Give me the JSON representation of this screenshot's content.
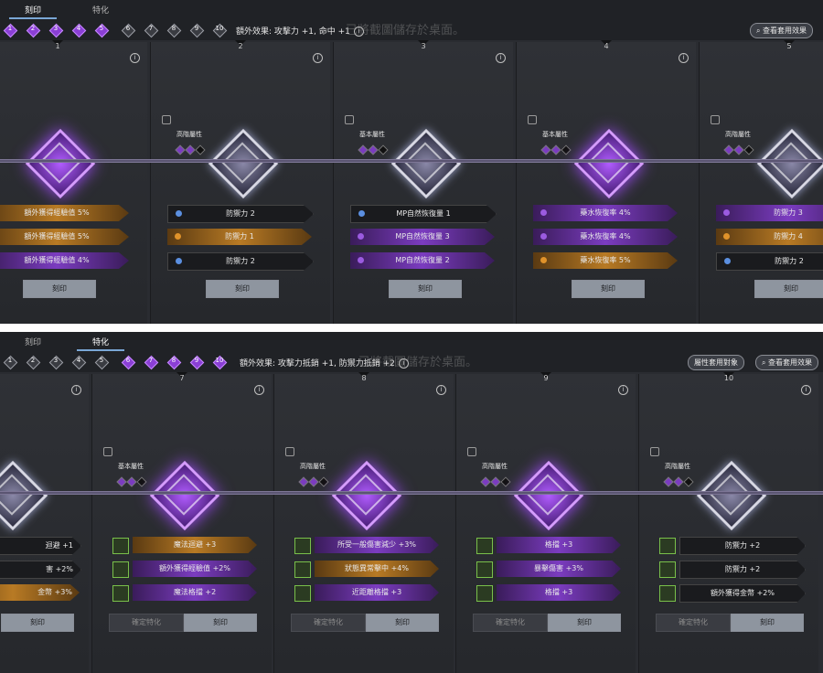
{
  "panel1": {
    "tabs": [
      "刻印",
      "特化"
    ],
    "active_tab": 0,
    "nodes": [
      "1",
      "2",
      "3",
      "4",
      "5",
      "6",
      "7",
      "8",
      "9",
      "10"
    ],
    "nodes_on": [
      0,
      1,
      2,
      3,
      4
    ],
    "bonus": "額外效果: 攻擊力 +1, 命中 +1",
    "toast": "已將截圖儲存於桌面。",
    "view_button": "查看套用效果",
    "columns": [
      {
        "num": "1",
        "attr": "",
        "gem": "purple",
        "rows": [
          {
            "t": "額外獲得經驗值 5%",
            "c": "orange"
          },
          {
            "t": "額外獲得經驗值 5%",
            "c": "orange"
          },
          {
            "t": "額外獲得經驗值 4%",
            "c": "purple"
          }
        ],
        "button": "刻印"
      },
      {
        "num": "2",
        "attr": "高階屬性",
        "gem": "silver",
        "rows": [
          {
            "t": "防禦力 2",
            "c": "dark"
          },
          {
            "t": "防禦力 1",
            "c": "orange"
          },
          {
            "t": "防禦力 2",
            "c": "dark"
          }
        ],
        "button": "刻印"
      },
      {
        "num": "3",
        "attr": "基本屬性",
        "gem": "silver",
        "rows": [
          {
            "t": "MP自然恢復量 1",
            "c": "dark"
          },
          {
            "t": "MP自然恢復量 3",
            "c": "purple"
          },
          {
            "t": "MP自然恢復量 2",
            "c": "purple"
          }
        ],
        "button": "刻印"
      },
      {
        "num": "4",
        "attr": "基本屬性",
        "gem": "purple",
        "rows": [
          {
            "t": "藥水恢復率 4%",
            "c": "purple"
          },
          {
            "t": "藥水恢復率 4%",
            "c": "purple"
          },
          {
            "t": "藥水恢復率 5%",
            "c": "orange"
          }
        ],
        "button": "刻印"
      },
      {
        "num": "5",
        "attr": "高階屬性",
        "gem": "silver",
        "rows": [
          {
            "t": "防禦力 3",
            "c": "purple"
          },
          {
            "t": "防禦力 4",
            "c": "orange"
          },
          {
            "t": "防禦力 2",
            "c": "dark"
          }
        ],
        "button": "刻印"
      }
    ]
  },
  "panel2": {
    "tabs": [
      "刻印",
      "特化"
    ],
    "active_tab": 1,
    "nodes": [
      "1",
      "2",
      "3",
      "4",
      "5",
      "6",
      "7",
      "8",
      "9",
      "10"
    ],
    "nodes_on": [
      5,
      6,
      7,
      8,
      9
    ],
    "bonus": "額外效果: 攻擊力抵銷 +1, 防禦力抵銷 +2",
    "toast": "已將截圖儲存於桌面。",
    "attr_button": "屬性套用對象",
    "view_button": "查看套用效果",
    "partial_rows": [
      "迴避 +1",
      "害 +2%",
      "金幣 +3%"
    ],
    "partial_button": "刻印",
    "columns": [
      {
        "num": "7",
        "attr": "基本屬性",
        "rows": [
          {
            "t": "魔法迴避 +3",
            "c": "orange"
          },
          {
            "t": "額外獲得經驗值 +2%",
            "c": "purple"
          },
          {
            "t": "魔法格擋 +2",
            "c": "purple"
          }
        ],
        "confirm": "確定特化",
        "button": "刻印"
      },
      {
        "num": "8",
        "attr": "高階屬性",
        "rows": [
          {
            "t": "所受一般傷害減少 +3%",
            "c": "purple"
          },
          {
            "t": "狀態異常擊中 +4%",
            "c": "orange"
          },
          {
            "t": "近距離格擋 +3",
            "c": "purple"
          }
        ],
        "confirm": "確定特化",
        "button": "刻印"
      },
      {
        "num": "9",
        "attr": "高階屬性",
        "rows": [
          {
            "t": "格擋 +3",
            "c": "purple"
          },
          {
            "t": "暴擊傷害 +3%",
            "c": "purple"
          },
          {
            "t": "格擋 +3",
            "c": "purple"
          }
        ],
        "confirm": "確定特化",
        "button": "刻印"
      },
      {
        "num": "10",
        "attr": "高階屬性",
        "rows": [
          {
            "t": "防禦力 +2",
            "c": "dark"
          },
          {
            "t": "防禦力 +2",
            "c": "dark"
          },
          {
            "t": "額外獲得金幣 +2%",
            "c": "dark"
          }
        ],
        "confirm": "確定特化",
        "button": "刻印"
      }
    ]
  },
  "colors": {
    "purple": "#8b3fd6",
    "orange": "#b87a24",
    "bg": "#2a2c31"
  }
}
